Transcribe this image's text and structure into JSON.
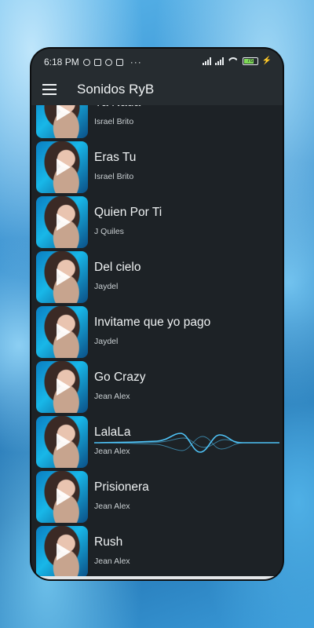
{
  "status_bar": {
    "time": "6:18 PM",
    "left_icons": [
      "alarm-icon",
      "chat-bubble-icon",
      "telegram-icon",
      "instagram-icon"
    ],
    "overflow": "···",
    "right_icons": [
      "signal-icon",
      "signal-icon",
      "wifi-icon",
      "battery-icon",
      "charging-bolt-icon"
    ],
    "battery_level": "76"
  },
  "app_bar": {
    "menu_icon": "hamburger-menu-icon",
    "title": "Sonidos RyB"
  },
  "songs": [
    {
      "title": "Ya Nada",
      "artist": "Israel Brito"
    },
    {
      "title": "Eras Tu",
      "artist": "Israel Brito"
    },
    {
      "title": "Quien Por Ti",
      "artist": "J Quiles"
    },
    {
      "title": "Del cielo",
      "artist": "Jaydel"
    },
    {
      "title": "Invitame que yo pago",
      "artist": "Jaydel"
    },
    {
      "title": "Go Crazy",
      "artist": "Jean  Alex"
    },
    {
      "title": "LalaLa",
      "artist": "Jean  Alex",
      "playing": true
    },
    {
      "title": "Prisionera",
      "artist": "Jean  Alex"
    },
    {
      "title": "Rush",
      "artist": "Jean  Alex"
    }
  ],
  "colors": {
    "background": "#1d2226",
    "app_bar": "#262c30",
    "wave_accent": "#4fc3f7",
    "text_primary": "#eef1f2",
    "text_secondary": "#c9cfd2"
  }
}
